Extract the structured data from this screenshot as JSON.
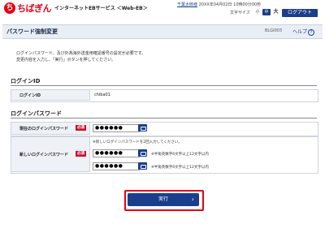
{
  "header": {
    "logo_mark": "ち",
    "logo_text": "ちばぎん",
    "service": "インターネットEBサービス ＜Web-EB＞",
    "user_name": "千葉太郎様",
    "last_login": "20XX年04月02日 10時00分00秒",
    "font_size_label": "文字サイズ",
    "font_small": "小",
    "font_medium": "中",
    "font_large": "大",
    "logout": "ログアウト"
  },
  "page": {
    "title": "パスワード強制変更",
    "id": "BLGI003",
    "help": "ヘルプ",
    "help_icon": "?",
    "note1": "ログインパスワード、及び外為海外送金用確認番号の設定が必要です。",
    "note2": "変更内容を入力し、「実行」ボタンを押してください。"
  },
  "login_id_section": {
    "heading": "ログインID",
    "label": "ログインID",
    "value": "chiba01"
  },
  "password_section": {
    "heading": "ログインパスワード",
    "current_label": "現在のログインパスワード",
    "new_label": "新しいログインパスワード",
    "required": "必須",
    "current_value": "●●●●●●",
    "new_note": "※新しいログインパスワードを2回入力してください。",
    "new_value1": "●●●●●●",
    "new_value2": "●●●●●●",
    "rule1": "※半角英数字6文字以上12文字以内",
    "rule2": "※半角英数字6文字以上12文字以内"
  },
  "submit": {
    "label": "実行",
    "arrow": "›"
  },
  "colors": {
    "brand_red": "#e60012",
    "navy": "#1a3e8c"
  }
}
